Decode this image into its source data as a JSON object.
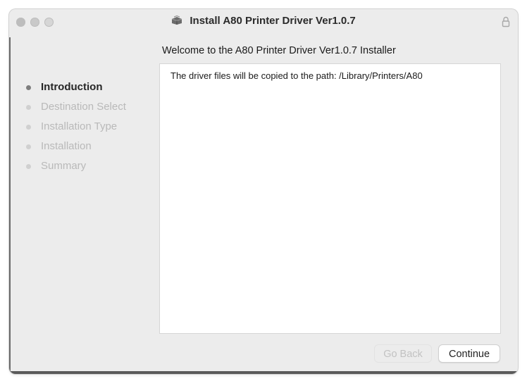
{
  "window": {
    "title": "Install A80 Printer Driver Ver1.0.7",
    "title_icon": "package-icon",
    "lock_icon": "lock-icon"
  },
  "header": {
    "subtitle": "Welcome to the A80 Printer Driver Ver1.0.7 Installer"
  },
  "sidebar": {
    "steps": [
      {
        "label": "Introduction",
        "active": true
      },
      {
        "label": "Destination Select",
        "active": false
      },
      {
        "label": "Installation Type",
        "active": false
      },
      {
        "label": "Installation",
        "active": false
      },
      {
        "label": "Summary",
        "active": false
      }
    ]
  },
  "content": {
    "message": "The driver files will be copied to the path: /Library/Printers/A80"
  },
  "buttons": {
    "back_label": "Go Back",
    "continue_label": "Continue"
  }
}
